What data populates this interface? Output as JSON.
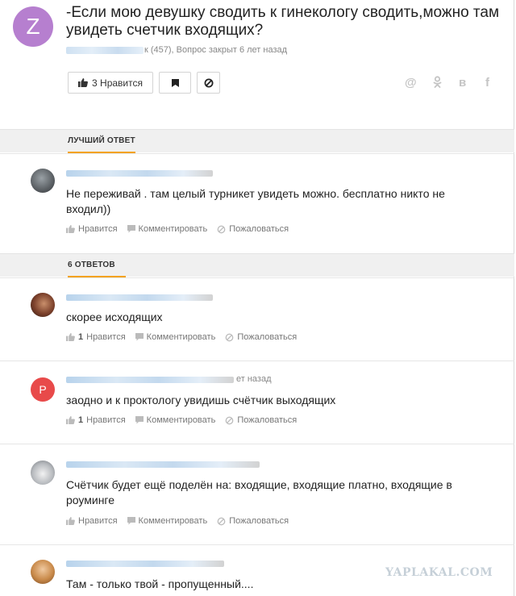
{
  "question": {
    "avatar_letter": "Z",
    "avatar_color": "#b67fcf",
    "title": "-Если мою девушку сводить к гинекологу сводить,можно там увидеть счетчик входящих?",
    "meta": "к (457), Вопрос закрыт 6 лет назад",
    "like_label": "3 Нравится",
    "social": [
      "@",
      "ok",
      "в",
      "f"
    ]
  },
  "best_answer": {
    "section_label": "ЛУЧШИЙ ОТВЕТ",
    "text": "Не переживай . там целый турникет увидеть можно. бесплатно никто не входил))",
    "actions": {
      "like": "Нравится",
      "comment": "Комментировать",
      "report": "Пожаловаться"
    }
  },
  "answers_section": {
    "label": "6 ОТВЕТОВ"
  },
  "answers": [
    {
      "text": "скорее исходящих",
      "like_count": "1",
      "like": "Нравится",
      "comment": "Комментировать",
      "report": "Пожаловаться"
    },
    {
      "avatar_letter": "P",
      "author_suffix": "ет назад",
      "text": "заодно и к проктологу увидишь счётчик выходящих",
      "like_count": "1",
      "like": "Нравится",
      "comment": "Комментировать",
      "report": "Пожаловаться"
    },
    {
      "text": "Счётчик будет ещё поделён на: входящие, входящие платно, входящие в роуминге",
      "like": "Нравится",
      "comment": "Комментировать",
      "report": "Пожаловаться"
    },
    {
      "text": "Там - только твой - пропущенный...."
    }
  ],
  "watermark": "YAPLAKAL.COM",
  "colors": {
    "accent": "#f3a21b",
    "avatar_p": "#e84a4a"
  }
}
